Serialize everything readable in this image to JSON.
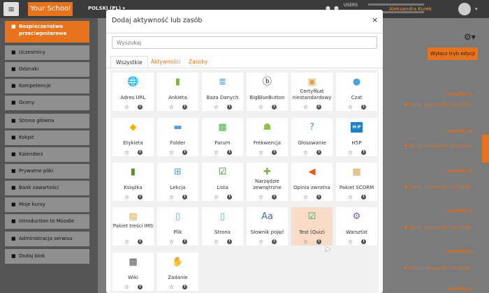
{
  "navbar": {
    "logo": "Your School",
    "lang": "POLSKI (PL) ▾",
    "users_label": "USERS",
    "user_name": "Aleksandra Kurek",
    "menu_glyph": "≡"
  },
  "sidebar": {
    "items": [
      {
        "label": "Bezpieczeństwo przeciwpożarowe",
        "icon": "graduation-cap-icon",
        "active": true
      },
      {
        "label": "Uczestnicy",
        "icon": "users-icon"
      },
      {
        "label": "Odznaki",
        "icon": "shield-icon"
      },
      {
        "label": "Kompetencje",
        "icon": "checkbox-icon"
      },
      {
        "label": "Oceny",
        "icon": "table-icon"
      },
      {
        "label": "Strona główna",
        "icon": "home-icon"
      },
      {
        "label": "Kokpit",
        "icon": "dashboard-icon"
      },
      {
        "label": "Kalendarz",
        "icon": "calendar-icon"
      },
      {
        "label": "Prywatne pliki",
        "icon": "file-icon"
      },
      {
        "label": "Bank zawartości",
        "icon": "paint-brush-icon"
      },
      {
        "label": "Moje kursy",
        "icon": "graduation-cap-icon"
      },
      {
        "label": "Introduction to Moodle",
        "icon": "graduation-cap-icon"
      },
      {
        "label": "Administracja serwisu",
        "icon": "wrench-icon"
      },
      {
        "label": "Dodaj blok",
        "icon": "plus-square-icon"
      }
    ]
  },
  "main": {
    "edit_button": "Wyłącz tryb edycji",
    "modify_label": "Modyfikuj ▾",
    "add_label": "Dodaj aktywność lub zasób"
  },
  "modal": {
    "title": "Dodaj aktywność lub zasób",
    "close": "×",
    "search_placeholder": "Wyszukaj",
    "tabs": [
      "Wszystkie",
      "Aktywności",
      "Zasoby"
    ],
    "selected": "Test (Quiz)",
    "items": [
      {
        "label": "Adres URL",
        "icon": "url-globe-icon",
        "glyph": "🌐",
        "color": "#3b8fd9"
      },
      {
        "label": "Ankieta",
        "icon": "bar-chart-icon",
        "glyph": "▮",
        "color": "#7cb342"
      },
      {
        "label": "Baza Danych",
        "icon": "database-icon",
        "glyph": "≣",
        "color": "#4a90e2"
      },
      {
        "label": "BigBlueButton",
        "icon": "bigbluebutton-icon",
        "glyph": "ⓑ",
        "color": "#222"
      },
      {
        "label": "Certyfikat niestandardowy",
        "icon": "certificate-icon",
        "glyph": "▣",
        "color": "#e6a23c"
      },
      {
        "label": "Czat",
        "icon": "chat-icon",
        "glyph": "●",
        "color": "#4aa3df"
      },
      {
        "label": "Etykieta",
        "icon": "tag-icon",
        "glyph": "◆",
        "color": "#f0b400"
      },
      {
        "label": "Folder",
        "icon": "folder-icon",
        "glyph": "▬",
        "color": "#5b9bd5"
      },
      {
        "label": "Forum",
        "icon": "forum-icon",
        "glyph": "▩",
        "color": "#4caf50"
      },
      {
        "label": "Frekwencja",
        "icon": "attendance-icon",
        "glyph": "☗",
        "color": "#8bc34a"
      },
      {
        "label": "Głosowanie",
        "icon": "question-icon",
        "glyph": "?",
        "color": "#4a90e2"
      },
      {
        "label": "H5P",
        "icon": "h5p-icon",
        "glyph": "H-P",
        "color": "#1f7fc9"
      },
      {
        "label": "Książka",
        "icon": "book-icon",
        "glyph": "▮",
        "color": "#5a8f2a"
      },
      {
        "label": "Lekcja",
        "icon": "lesson-icon",
        "glyph": "⊞",
        "color": "#5b9bd5"
      },
      {
        "label": "Lista",
        "icon": "checklist-icon",
        "glyph": "☑",
        "color": "#3a7d3a"
      },
      {
        "label": "Narzędzie zewnętrzne",
        "icon": "puzzle-icon",
        "glyph": "✚",
        "color": "#7cb342"
      },
      {
        "label": "Opinia zwrotna",
        "icon": "megaphone-icon",
        "glyph": "◀",
        "color": "#e05a1a"
      },
      {
        "label": "Pakiet SCORM",
        "icon": "scorm-icon",
        "glyph": "▦",
        "color": "#e6a23c"
      },
      {
        "label": "Pakiet treści IMS",
        "icon": "ims-icon",
        "glyph": "▤",
        "color": "#e6a23c"
      },
      {
        "label": "Plik",
        "icon": "file-icon",
        "glyph": "▯",
        "color": "#7aa7d9"
      },
      {
        "label": "Strona",
        "icon": "page-icon",
        "glyph": "▯",
        "color": "#7aa7d9"
      },
      {
        "label": "Słownik pojęć",
        "icon": "glossary-icon",
        "glyph": "Aa",
        "color": "#4a6fa5"
      },
      {
        "label": "Test (Quiz)",
        "icon": "quiz-icon",
        "glyph": "☑",
        "color": "#3aa35a"
      },
      {
        "label": "Warsztat",
        "icon": "workshop-icon",
        "glyph": "⚙",
        "color": "#7a5bb5"
      },
      {
        "label": "Wiki",
        "icon": "wiki-icon",
        "glyph": "▩",
        "color": "#555"
      },
      {
        "label": "Zadanie",
        "icon": "assignment-icon",
        "glyph": "✋",
        "color": "#e0a070"
      }
    ]
  }
}
